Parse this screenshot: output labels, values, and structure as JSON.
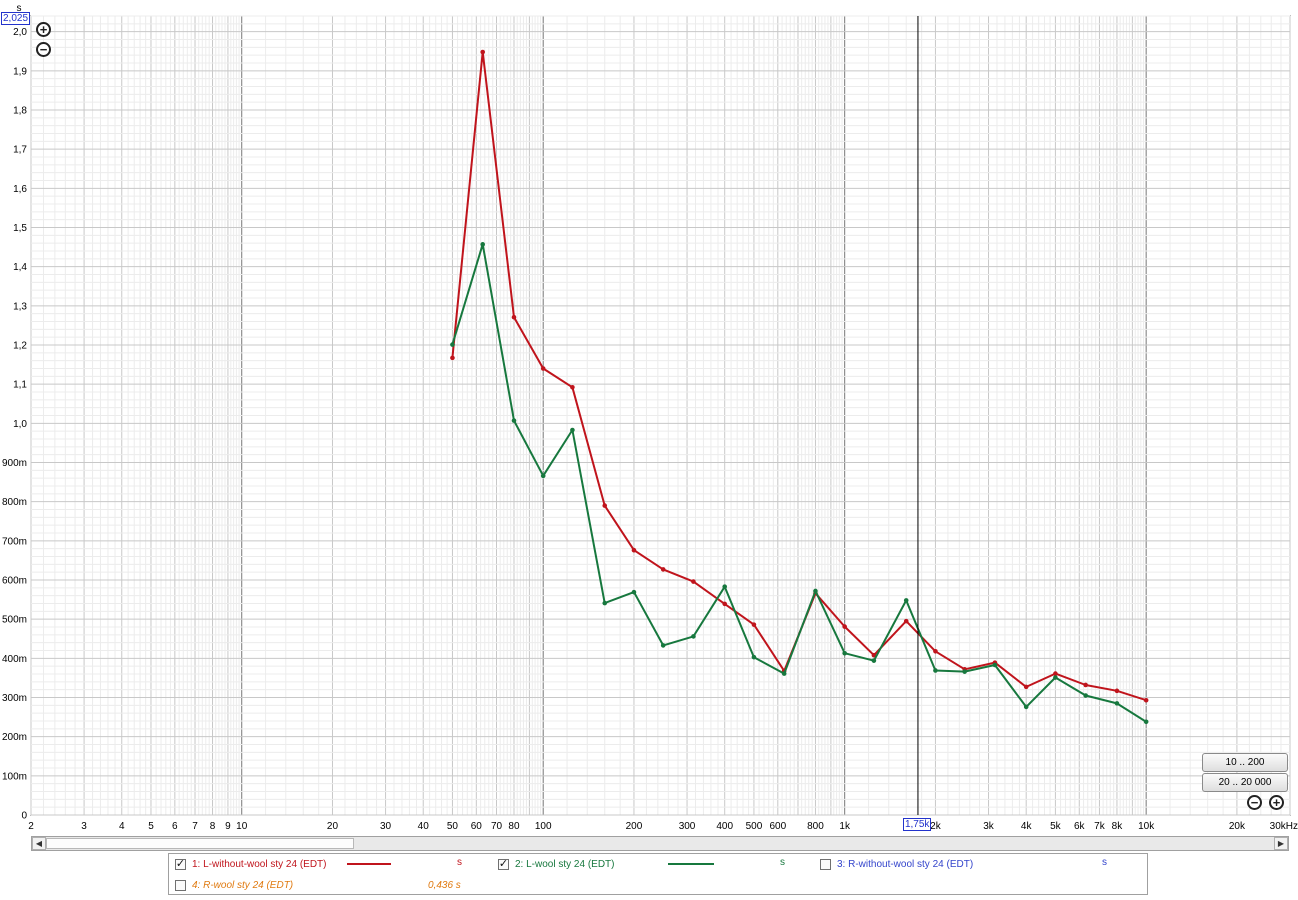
{
  "chart_data": {
    "type": "line",
    "x_scale": "log",
    "xlim": [
      2,
      30000
    ],
    "ylim": [
      0,
      2.04
    ],
    "y_unit_label": "s",
    "grid": true,
    "x_major_ticks": [
      {
        "v": 2,
        "label": "2"
      },
      {
        "v": 3,
        "label": "3"
      },
      {
        "v": 4,
        "label": "4"
      },
      {
        "v": 5,
        "label": "5"
      },
      {
        "v": 6,
        "label": "6"
      },
      {
        "v": 7,
        "label": "7"
      },
      {
        "v": 8,
        "label": "8"
      },
      {
        "v": 9,
        "label": "9"
      },
      {
        "v": 10,
        "label": "10"
      },
      {
        "v": 20,
        "label": "20"
      },
      {
        "v": 30,
        "label": "30"
      },
      {
        "v": 40,
        "label": "40"
      },
      {
        "v": 50,
        "label": "50"
      },
      {
        "v": 60,
        "label": "60"
      },
      {
        "v": 70,
        "label": "70"
      },
      {
        "v": 80,
        "label": "80"
      },
      {
        "v": 100,
        "label": "100"
      },
      {
        "v": 200,
        "label": "200"
      },
      {
        "v": 300,
        "label": "300"
      },
      {
        "v": 400,
        "label": "400"
      },
      {
        "v": 500,
        "label": "500"
      },
      {
        "v": 600,
        "label": "600"
      },
      {
        "v": 800,
        "label": "800"
      },
      {
        "v": 1000,
        "label": "1k"
      },
      {
        "v": 2000,
        "label": "2k"
      },
      {
        "v": 3000,
        "label": "3k"
      },
      {
        "v": 4000,
        "label": "4k"
      },
      {
        "v": 5000,
        "label": "5k"
      },
      {
        "v": 6000,
        "label": "6k"
      },
      {
        "v": 7000,
        "label": "7k"
      },
      {
        "v": 8000,
        "label": "8k"
      },
      {
        "v": 10000,
        "label": "10k"
      },
      {
        "v": 20000,
        "label": "20k"
      },
      {
        "v": 30000,
        "label": "30kHz"
      }
    ],
    "y_ticks": [
      {
        "v": 0,
        "label": "0"
      },
      {
        "v": 0.1,
        "label": "100m"
      },
      {
        "v": 0.2,
        "label": "200m"
      },
      {
        "v": 0.3,
        "label": "300m"
      },
      {
        "v": 0.4,
        "label": "400m"
      },
      {
        "v": 0.5,
        "label": "500m"
      },
      {
        "v": 0.6,
        "label": "600m"
      },
      {
        "v": 0.7,
        "label": "700m"
      },
      {
        "v": 0.8,
        "label": "800m"
      },
      {
        "v": 0.9,
        "label": "900m"
      },
      {
        "v": 1.0,
        "label": "1,0"
      },
      {
        "v": 1.1,
        "label": "1,1"
      },
      {
        "v": 1.2,
        "label": "1,2"
      },
      {
        "v": 1.3,
        "label": "1,3"
      },
      {
        "v": 1.4,
        "label": "1,4"
      },
      {
        "v": 1.5,
        "label": "1,5"
      },
      {
        "v": 1.6,
        "label": "1,6"
      },
      {
        "v": 1.7,
        "label": "1,7"
      },
      {
        "v": 1.8,
        "label": "1,8"
      },
      {
        "v": 1.9,
        "label": "1,9"
      },
      {
        "v": 2.0,
        "label": "2,0"
      }
    ],
    "x": [
      50,
      63,
      80,
      100,
      125,
      160,
      200,
      250,
      315,
      400,
      500,
      630,
      800,
      1000,
      1250,
      1600,
      2000,
      2500,
      3150,
      4000,
      5000,
      6300,
      8000,
      10000
    ],
    "series": [
      {
        "name": "1: L-without-wool sty 24 (EDT)",
        "color": "#c0141c",
        "values": [
          1.167,
          1.948,
          1.271,
          1.14,
          1.092,
          0.79,
          0.676,
          0.627,
          0.596,
          0.539,
          0.486,
          0.368,
          0.566,
          0.481,
          0.408,
          0.495,
          0.418,
          0.372,
          0.389,
          0.327,
          0.361,
          0.332,
          0.317,
          0.293
        ]
      },
      {
        "name": "2: L-wool sty 24 (EDT)",
        "color": "#17783e",
        "values": [
          1.201,
          1.457,
          1.007,
          0.866,
          0.983,
          0.541,
          0.569,
          0.433,
          0.456,
          0.583,
          0.403,
          0.361,
          0.572,
          0.413,
          0.394,
          0.548,
          0.369,
          0.366,
          0.383,
          0.276,
          0.351,
          0.305,
          0.285,
          0.238
        ]
      }
    ],
    "cursor": {
      "x_label": "1,75k",
      "y_label": "2,025",
      "color": "#2233cc"
    },
    "legend": {
      "placement": "bottom",
      "entries": [
        {
          "checked": true,
          "name": "1: L-without-wool sty 24 (EDT)",
          "color": "#c0141c",
          "value": "s",
          "value_color": "#c0141c"
        },
        {
          "checked": true,
          "name": "2: L-wool sty 24 (EDT)",
          "color": "#17783e",
          "value": "s",
          "value_color": "#17783e"
        },
        {
          "checked": false,
          "name": "3: R-without-wool sty 24 (EDT)",
          "color": "#3344cc",
          "value": "s",
          "value_color": "#3344cc"
        },
        {
          "checked": false,
          "name": "4: R-wool sty 24 (EDT)",
          "color": "#e07a10",
          "value": "0,436 s",
          "value_color": "#e07a10"
        }
      ]
    }
  },
  "controls": {
    "zoom_in_symbol": "+",
    "zoom_out_symbol": "−",
    "range_btn_1": "10 .. 200",
    "range_btn_2": "20 .. 20 000",
    "scroll_left": "◀",
    "scroll_right": "▶",
    "check_mark": "✓"
  }
}
